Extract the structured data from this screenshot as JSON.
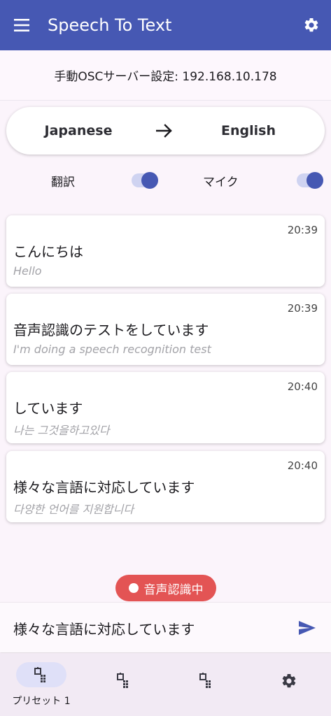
{
  "app": {
    "title": "Speech To Text",
    "menu_icon": "menu-icon",
    "settings_icon": "gear-icon"
  },
  "osc": {
    "text": "手動OSCサーバー設定: 192.168.10.178"
  },
  "languages": {
    "source": "Japanese",
    "target": "English",
    "arrow_icon": "arrow-right-icon"
  },
  "toggles": [
    {
      "label": "翻訳",
      "on": true
    },
    {
      "label": "マイク",
      "on": true
    }
  ],
  "messages": [
    {
      "time": "20:39",
      "original": "こんにちは",
      "translation": "Hello"
    },
    {
      "time": "20:39",
      "original": "音声認識のテストをしています",
      "translation": "I'm doing a speech recognition test"
    },
    {
      "time": "20:40",
      "original": "しています",
      "translation": "나는 그것을하고있다"
    },
    {
      "time": "20:40",
      "original": "様々な言語に対応しています",
      "translation": "다양한 언어를 지원합니다"
    }
  ],
  "status": {
    "label": "音声認識中",
    "color": "#e35454"
  },
  "input": {
    "value": "様々な言語に対応しています",
    "send_icon": "send-icon"
  },
  "bottom_nav": [
    {
      "label": "プリセット 1",
      "icon": "preset-icon",
      "active": true
    },
    {
      "label": "",
      "icon": "preset-icon",
      "active": false
    },
    {
      "label": "",
      "icon": "preset-icon",
      "active": false
    },
    {
      "label": "",
      "icon": "gear-icon",
      "active": false
    }
  ],
  "colors": {
    "primary": "#4658b3",
    "background": "#fbf4fb",
    "switch_track": "#cfd3f1"
  }
}
